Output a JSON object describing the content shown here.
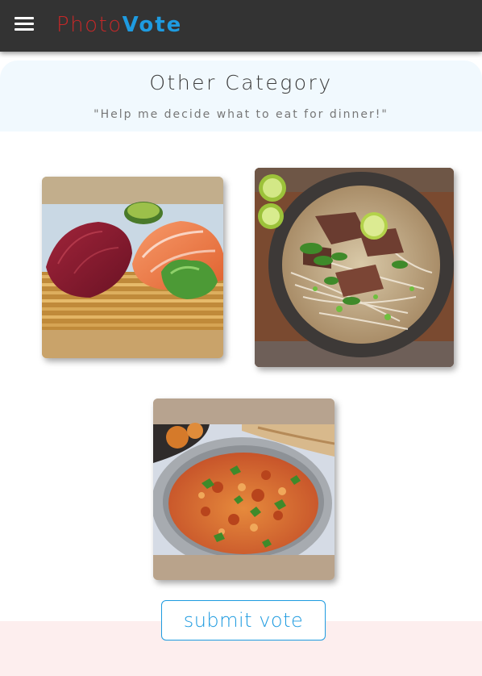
{
  "navbar": {
    "menu_icon": "hamburger-menu-icon",
    "logo_part1": "Photo",
    "logo_part2": "Vote"
  },
  "category": {
    "title": "Other Category",
    "subtitle": "\"Help me decide what to eat for dinner!\""
  },
  "photos": [
    {
      "subject": "sashimi"
    },
    {
      "subject": "pho noodle soup"
    },
    {
      "subject": "curry"
    }
  ],
  "submit_button": {
    "label": "submit vote"
  },
  "colors": {
    "navbar": "#333333",
    "logo_red": "#c62828",
    "accent_blue": "#1e9be0",
    "header_band": "#f1f9fe",
    "footer_band": "#fdeeee"
  }
}
